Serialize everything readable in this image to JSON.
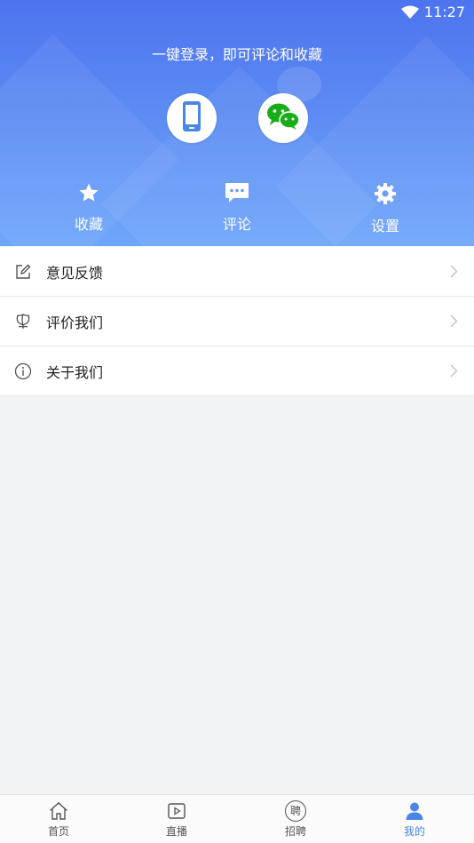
{
  "status_bar": {
    "time": "11:27",
    "wifi_icon": "wifi-icon"
  },
  "header": {
    "login_hint": "一键登录，即可评论和收藏",
    "login_options": [
      {
        "name": "phone-login",
        "icon": "phone-icon"
      },
      {
        "name": "wechat-login",
        "icon": "wechat-icon"
      }
    ],
    "quick_actions": [
      {
        "label": "收藏",
        "icon": "star-icon"
      },
      {
        "label": "评论",
        "icon": "comment-icon"
      },
      {
        "label": "设置",
        "icon": "gear-icon"
      }
    ]
  },
  "menu": [
    {
      "label": "意见反馈",
      "icon": "edit-icon"
    },
    {
      "label": "评价我们",
      "icon": "flower-icon"
    },
    {
      "label": "关于我们",
      "icon": "info-icon"
    }
  ],
  "tabbar": {
    "tabs": [
      {
        "label": "首页",
        "icon": "home-icon"
      },
      {
        "label": "直播",
        "icon": "play-icon"
      },
      {
        "label": "招聘",
        "icon": "recruit-icon",
        "glyph": "聘"
      },
      {
        "label": "我的",
        "icon": "user-icon",
        "active": true
      }
    ]
  },
  "colors": {
    "accent": "#4a86e8",
    "header_top": "#4d74ef",
    "header_bottom": "#6fa6fb",
    "wechat_green": "#1aad19"
  }
}
